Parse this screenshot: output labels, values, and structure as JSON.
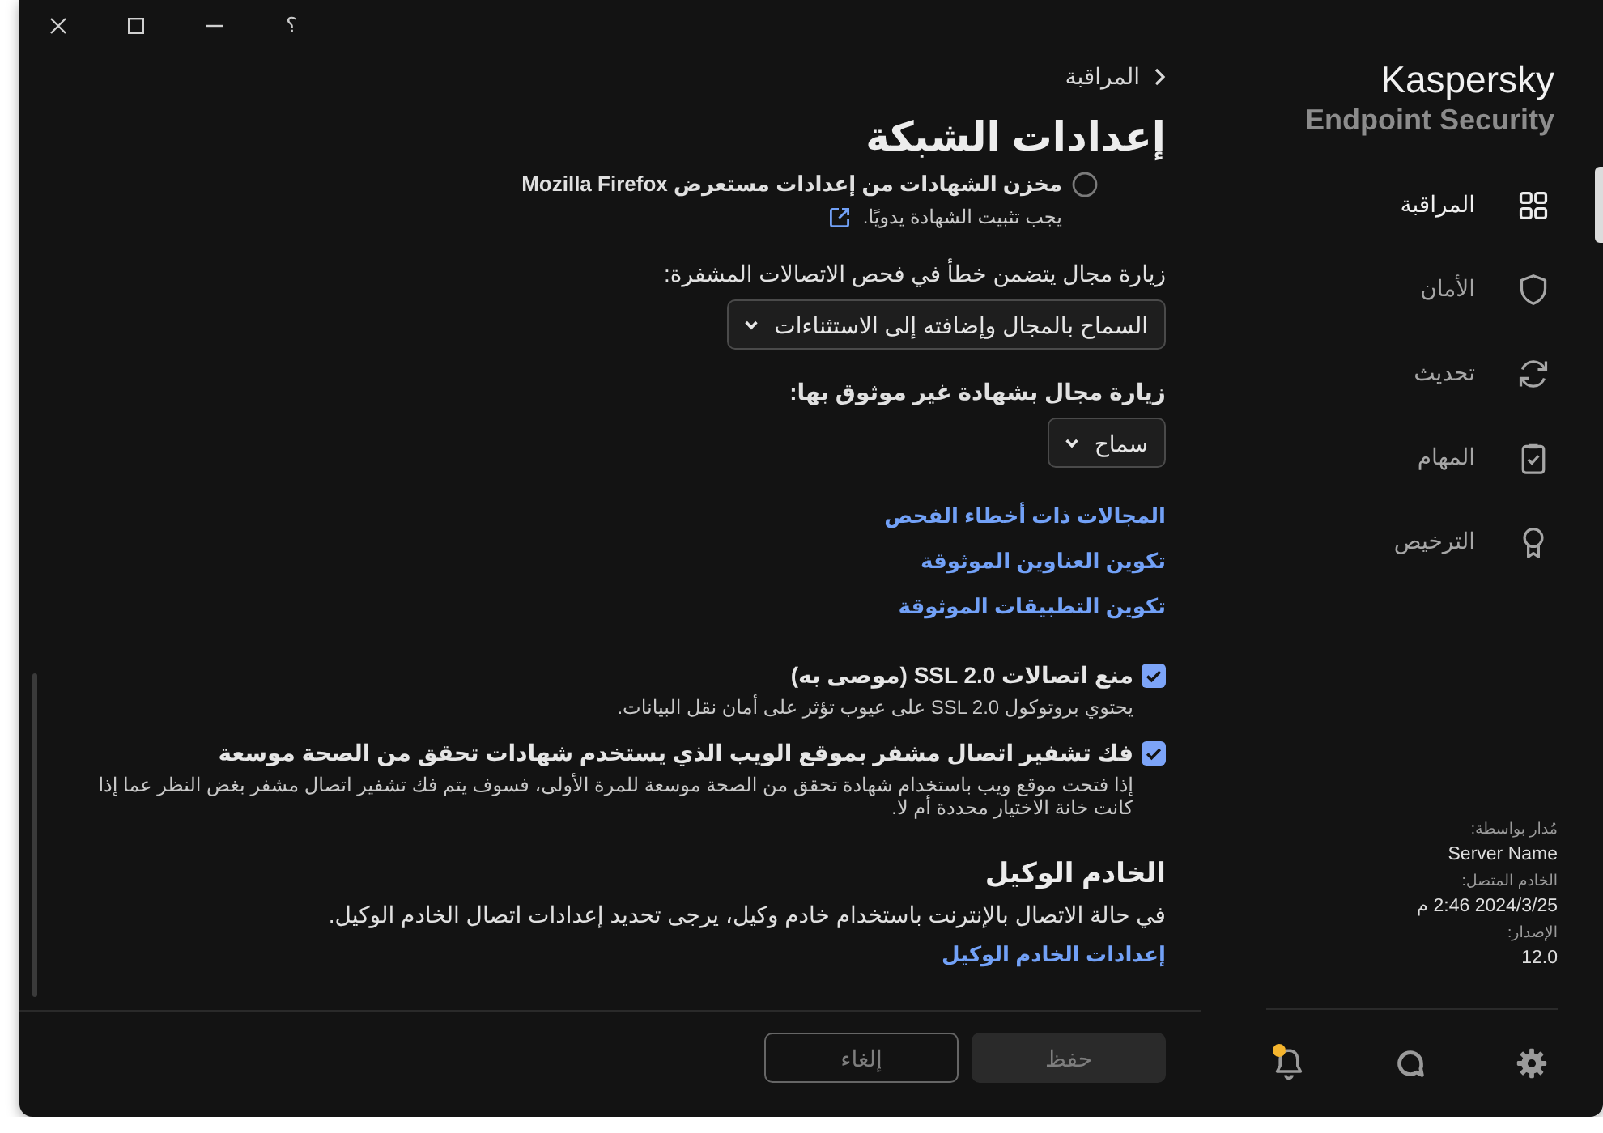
{
  "window": {
    "help": "؟"
  },
  "sidebar": {
    "brand": "Kaspersky",
    "product": "Endpoint Security",
    "items": [
      {
        "label": "المراقبة",
        "selected": true
      },
      {
        "label": "الأمان",
        "selected": false
      },
      {
        "label": "تحديث",
        "selected": false
      },
      {
        "label": "المهام",
        "selected": false
      },
      {
        "label": "الترخيص",
        "selected": false
      }
    ],
    "info": [
      {
        "label": "مُدار بواسطة:",
        "value": "Server Name"
      },
      {
        "label": "الخادم المتصل:",
        "value": "2024/3/25 2:46 م"
      },
      {
        "label": "الإصدار:",
        "value": "12.0"
      }
    ],
    "notification": true
  },
  "header": {
    "breadcrumb": "المراقبة",
    "title": "إعدادات الشبكة"
  },
  "content": {
    "radio": {
      "label": "مخزن الشهادات من إعدادات مستعرض Mozilla Firefox",
      "selected": false,
      "note": "يجب تثبيت الشهادة يدويًا."
    },
    "fields": [
      {
        "label": "زيارة مجال يتضمن خطأ في فحص الاتصالات المشفرة:",
        "bold": false,
        "value": "السماح بالمجال وإضافته إلى الاستثناءات"
      },
      {
        "label": "زيارة مجال بشهادة غير موثوق بها:",
        "bold": true,
        "value": "سماح"
      }
    ],
    "links": [
      "المجالات ذات أخطاء الفحص",
      "تكوين العناوين الموثوقة",
      "تكوين التطبيقات الموثوقة"
    ],
    "checkboxes": [
      {
        "label": "منع اتصالات SSL 2.0 (موصى به)",
        "checked": true,
        "description": "يحتوي بروتوكول SSL 2.0 على عيوب تؤثر على أمان نقل البيانات."
      },
      {
        "label": "فك تشفير اتصال مشفر بموقع الويب الذي يستخدم شهادات تحقق من الصحة موسعة",
        "checked": true,
        "description": "إذا فتحت موقع ويب باستخدام شهادة تحقق من الصحة موسعة للمرة الأولى، فسوف يتم فك تشفير اتصال مشفر بغض النظر عما إذا كانت خانة الاختيار محددة أم لا."
      }
    ],
    "proxy": {
      "heading": "الخادم الوكيل",
      "text": "في حالة الاتصال بالإنترنت باستخدام خادم وكيل، يرجى تحديد إعدادات اتصال الخادم الوكيل.",
      "link": "إعدادات الخادم الوكيل"
    }
  },
  "footer": {
    "buttons": [
      {
        "label": "حفظ",
        "disabled": true
      },
      {
        "label": "إلغاء",
        "disabled": true
      }
    ]
  }
}
